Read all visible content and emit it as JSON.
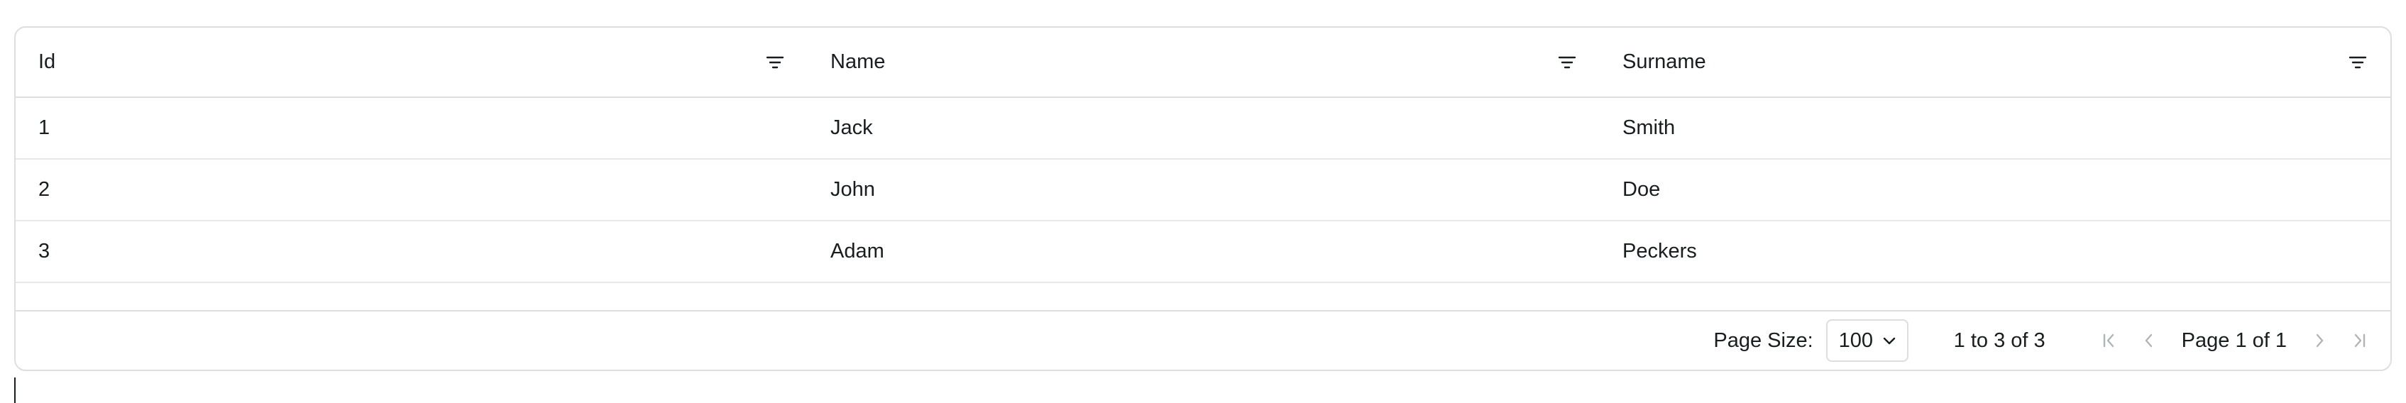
{
  "columns": [
    {
      "label": "Id"
    },
    {
      "label": "Name"
    },
    {
      "label": "Surname"
    }
  ],
  "rows": [
    {
      "id": "1",
      "name": "Jack",
      "surname": "Smith"
    },
    {
      "id": "2",
      "name": "John",
      "surname": "Doe"
    },
    {
      "id": "3",
      "name": "Adam",
      "surname": "Peckers"
    }
  ],
  "pagination": {
    "page_size_label": "Page Size:",
    "page_size_value": "100",
    "summary": "1 to 3 of 3",
    "page_text": "Page 1 of 1"
  },
  "icons": {
    "filter": "filter-icon",
    "first": "first-page-icon",
    "prev": "previous-page-icon",
    "next": "next-page-icon",
    "last": "last-page-icon",
    "dropdown": "chevron-down-icon"
  },
  "colors": {
    "border": "#dcdee0",
    "text": "#181d1f",
    "disabled_icon": "#b0b4b8"
  }
}
